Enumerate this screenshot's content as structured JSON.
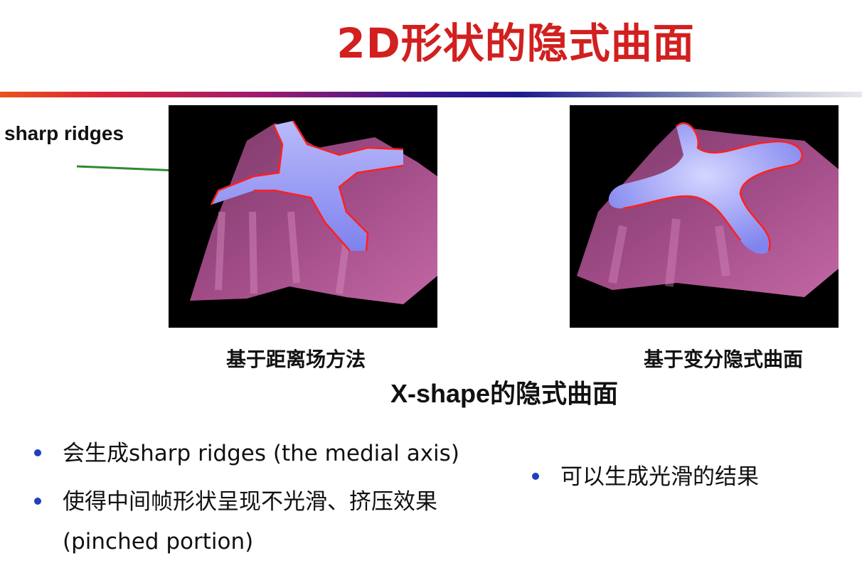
{
  "title": "2D形状的隐式曲面",
  "annotation": "sharp ridges",
  "captions": {
    "left": "基于距离场方法",
    "right": "基于变分隐式曲面",
    "subtitle": "X-shape的隐式曲面"
  },
  "bullets_left": [
    "会生成sharp ridges (the medial axis)",
    "使得中间帧形状呈现不光滑、挤压效果",
    "(pinched portion)"
  ],
  "bullets_right": [
    "可以生成光滑的结果"
  ],
  "colors": {
    "title": "#d21f1f",
    "bullet": "#1f3fbf",
    "arrow": "#2e8b2e",
    "surface": "#a04b86",
    "surface_light": "#d98bc0",
    "top": "#9a9cf5",
    "contour": "#ff2020"
  }
}
